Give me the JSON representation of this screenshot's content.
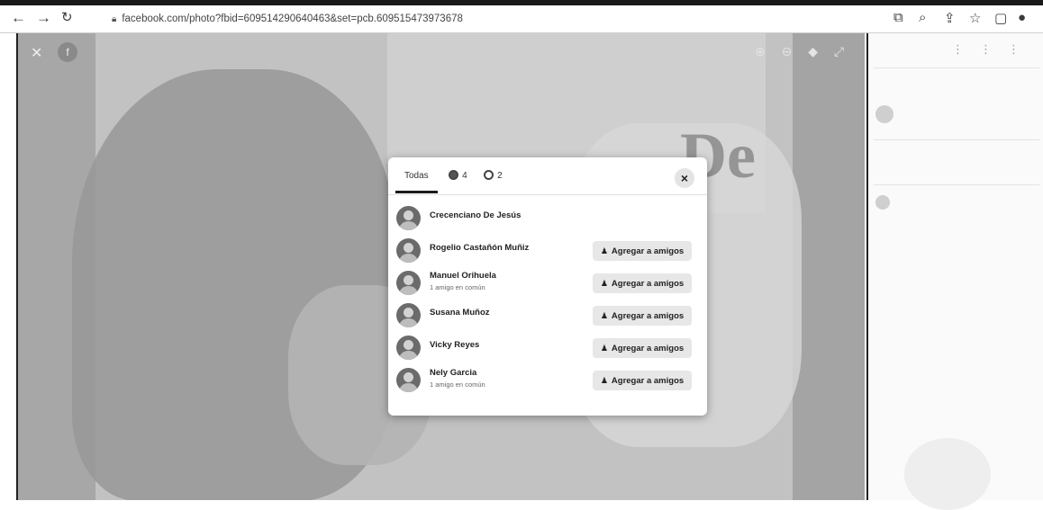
{
  "browser": {
    "url": "facebook.com/photo?fbid=609514290640463&set=pcb.609515473973678"
  },
  "modal": {
    "tabs": [
      {
        "label": "Todas"
      },
      {
        "count": "4"
      },
      {
        "count": "2"
      }
    ],
    "close_label": "×",
    "people": [
      {
        "name": "Crecenciano De Jesús",
        "mutual": "",
        "button": ""
      },
      {
        "name": "Rogelio Castañón Muñiz",
        "mutual": "",
        "button": "Agregar a amigos"
      },
      {
        "name": "Manuel Orihuela",
        "mutual": "1 amigo en común",
        "button": "Agregar a amigos"
      },
      {
        "name": "Susana Muñoz",
        "mutual": "",
        "button": "Agregar a amigos"
      },
      {
        "name": "Vicky Reyes",
        "mutual": "",
        "button": "Agregar a amigos"
      },
      {
        "name": "Nely Garcia",
        "mutual": "1 amigo en común",
        "button": "Agregar a amigos"
      }
    ]
  },
  "photo": {
    "visible_word": "De"
  },
  "icons": {
    "back": "arrow-left-icon",
    "forward": "arrow-right-icon",
    "reload": "reload-icon",
    "lock": "lock-icon",
    "add_friend": "add-friend-icon"
  },
  "colors": {
    "modal_bg": "#ffffff",
    "button_bg": "#e7e7e7",
    "tab_underline": "#1a1a1a"
  }
}
